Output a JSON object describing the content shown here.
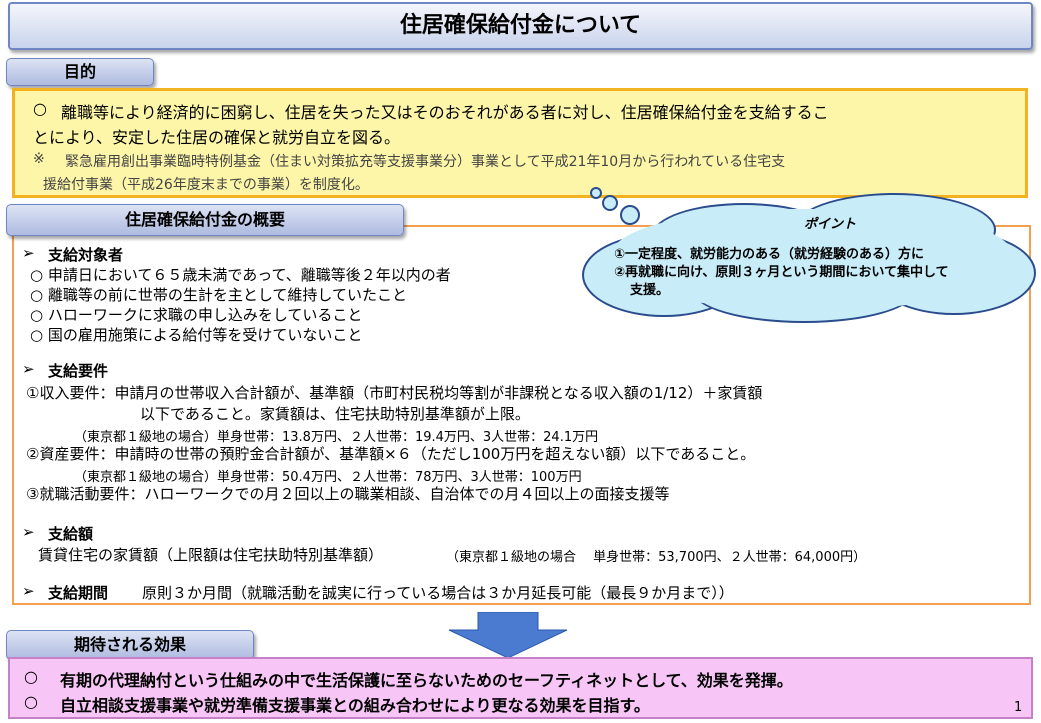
{
  "title": "住居確保給付金について",
  "purpose": {
    "tab": "目的",
    "marker": "○",
    "line1": "離職等により経済的に困窮し、住居を失った又はそのおそれがある者に対し、住居確保給付金を支給するこ",
    "line2": "とにより、安定した住居の確保と就労自立を図る。",
    "note_marker": "※",
    "note1": "緊急雇用創出事業臨時特例基金（住まい対策拡充等支援事業分）事業として平成21年10月から行われている住宅支",
    "note2": "援給付事業（平成26年度末までの事業）を制度化。"
  },
  "point": {
    "title": "ポイント",
    "item1": "①一定程度、就労能力のある（就労経験のある）方に",
    "item2": "②再就職に向け、原則３ヶ月という期間において集中して",
    "item2b": "支援。"
  },
  "overview": {
    "tab": "住居確保給付金の概要",
    "arrow": "➢",
    "eligibility": {
      "heading": "支給対象者",
      "items": [
        "○ 申請日において６５歳未満であって、離職等後２年以内の者",
        "○ 離職等の前に世帯の生計を主として維持していたこと",
        "○ ハローワークに求職の申し込みをしていること",
        "○ 国の雇用施策による給付等を受けていないこと"
      ]
    },
    "requirements": {
      "heading": "支給要件",
      "income1": "①収入要件：申請月の世帯収入合計額が、基準額（市町村民税均等割が非課税となる収入額の1/12）＋家賃額",
      "income2": "以下であること。家賃額は、住宅扶助特別基準額が上限。",
      "income_ex": "（東京都１級地の場合）単身世帯：13.8万円、２人世帯：19.4万円、3人世帯：24.1万円",
      "assets": "②資産要件：申請時の世帯の預貯金合計額が、基準額×６（ただし100万円を超えない額）以下であること。",
      "assets_ex": "（東京都１級地の場合）単身世帯：50.4万円、２人世帯：78万円、3人世帯：100万円",
      "job": "③就職活動要件：ハローワークでの月２回以上の職業相談、自治体での月４回以上の面接支援等"
    },
    "amount": {
      "heading": "支給額",
      "text": "賃貸住宅の家賃額（上限額は住宅扶助特別基準額）",
      "example": "（東京都１級地の場合　 単身世帯：53,700円、２人世帯：64,000円）"
    },
    "period": {
      "heading": "支給期間",
      "text": "原則３か月間（就職活動を誠実に行っている場合は３か月延長可能（最長９か月まで））"
    }
  },
  "effects": {
    "tab": "期待される効果",
    "items": [
      "有期の代理納付という仕組みの中で生活保護に至らないためのセーフティネットとして、効果を発揮。",
      "自立相談支援事業や就労準備支援事業との組み合わせにより更なる効果を目指す。"
    ],
    "marker": "○"
  },
  "page_number": "1",
  "colors": {
    "title_border": "#6f86c4",
    "purpose_bg": "#fdf6a8",
    "purpose_border": "#f2b11e",
    "overview_border": "#f0a050",
    "effect_bg": "#f7c6f6",
    "arrow": "#4a7bd0",
    "cloud": "#c8ecf8"
  }
}
